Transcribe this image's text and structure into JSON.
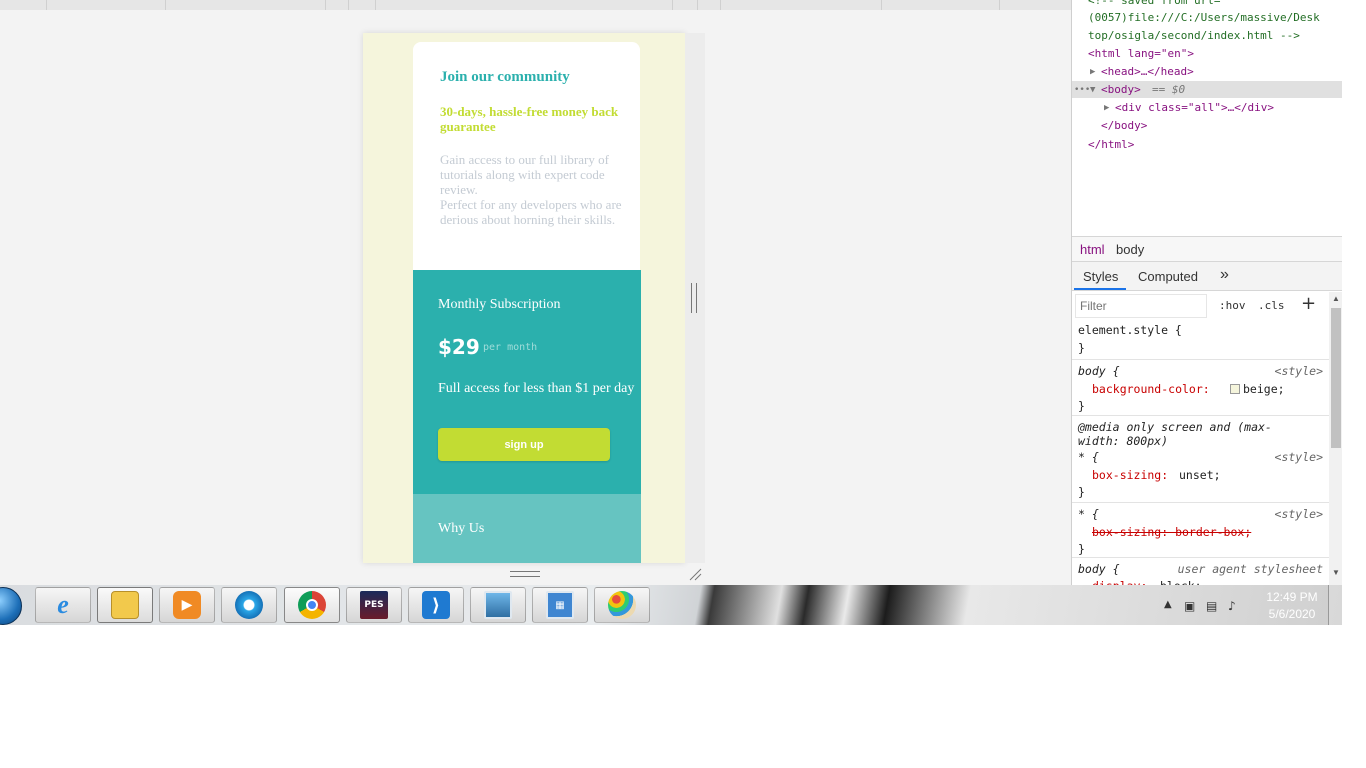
{
  "page": {
    "heading": "Join our community",
    "subheading": "30-days, hassle-free money back guarantee",
    "description_1": "Gain access to our full library of tutorials along with expert code review.",
    "description_2": "Perfect for any developers who are derious about horning their skills.",
    "subscription_title": "Monthly Subscription",
    "price": "$29",
    "price_unit": "per month",
    "access_text": "Full access for less than $1 per day",
    "signup_label": "sign up",
    "why_title": "Why Us",
    "colors": {
      "background": "#f5f5dc",
      "accent_teal": "#2bb0ad",
      "accent_lime": "#c2dc33",
      "light_teal": "#66c4c1"
    }
  },
  "devtools": {
    "dom": {
      "comment_1": "<!-- saved from url=",
      "comment_2": "(0057)file:///C:/Users/massive/Desk",
      "comment_3": "top/osigla/second/index.html -->",
      "html_open": "<html lang=\"en\">",
      "head": "<head>…</head>",
      "body_open": "<body>",
      "body_eq": "== $0",
      "div_all": "<div class=\"all\">…</div>",
      "body_close": "</body>",
      "html_close": "</html>"
    },
    "breadcrumbs": [
      "html",
      "body"
    ],
    "tabs": [
      "Styles",
      "Computed"
    ],
    "tabs_more": "»",
    "filter_placeholder": "Filter",
    "hov": ":hov",
    "cls": ".cls",
    "plus": "+",
    "rules": {
      "r1_selector": "element.style {",
      "r1_close": "}",
      "r2_selector": "body {",
      "r2_source": "<style>",
      "r2_prop": "background-color:",
      "r2_value": "beige;",
      "r2_close": "}",
      "r3_media_1": "@media only screen and (max-",
      "r3_media_2": "width: 800px)",
      "r3_selector": "* {",
      "r3_source": "<style>",
      "r3_prop": "box-sizing:",
      "r3_value": "unset;",
      "r3_close": "}",
      "r4_selector": "* {",
      "r4_source": "<style>",
      "r4_struck": "box-sizing: border-box;",
      "r4_close": "}",
      "r5_selector": "body {",
      "r5_source": "user agent stylesheet",
      "r5_prop": "display:",
      "r5_value": "block;"
    }
  },
  "taskbar": {
    "apps": [
      "windows-explorer-icon",
      "internet-explorer-icon",
      "file-manager-icon",
      "media-player-icon",
      "browser-blue-icon",
      "chrome-icon",
      "pes-game-icon",
      "vscode-icon",
      "photo-viewer-icon",
      "control-panel-icon",
      "paint-icon"
    ],
    "pes_label": "PES",
    "time": "12:49 PM",
    "date": "5/6/2020"
  }
}
